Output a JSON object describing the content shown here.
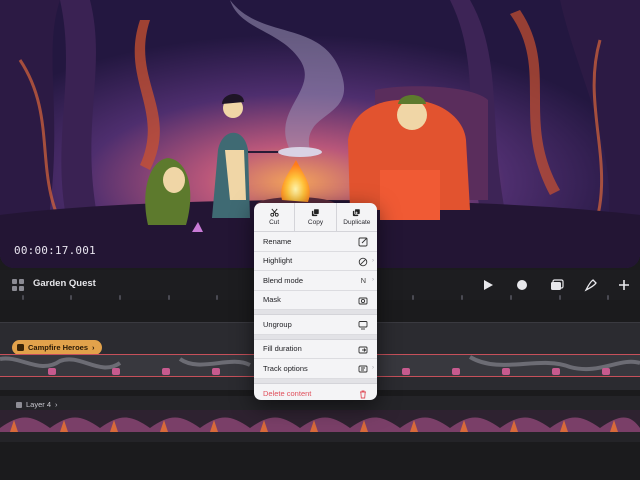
{
  "preview": {
    "timecode": "00:00:17.001"
  },
  "timeline": {
    "project_title": "Garden Quest",
    "toolbar": {
      "play": "play-icon",
      "record": "record-icon",
      "layers": "layers-icon",
      "draw": "brush-icon",
      "add": "plus-icon"
    },
    "tracks": [
      {
        "label": "Campfire Heroes",
        "type": "group"
      },
      {
        "label": "Layer 4",
        "type": "layer"
      }
    ]
  },
  "context_menu": {
    "top_actions": [
      {
        "label": "Cut",
        "icon": "scissors-icon"
      },
      {
        "label": "Copy",
        "icon": "copy-icon"
      },
      {
        "label": "Duplicate",
        "icon": "duplicate-icon"
      }
    ],
    "items": [
      {
        "label": "Rename",
        "icon": "edit-icon"
      },
      {
        "label": "Highlight",
        "icon": "slash-circle-icon"
      },
      {
        "label": "Blend mode",
        "value": "N"
      },
      {
        "label": "Mask",
        "icon": "mask-icon"
      },
      {
        "label": "Ungroup",
        "icon": "monitor-icon"
      },
      {
        "label": "Fill duration",
        "icon": "fill-duration-icon"
      },
      {
        "label": "Track options",
        "icon": "track-options-icon"
      },
      {
        "label": "Delete content",
        "icon": "trash-icon"
      }
    ],
    "colors": {
      "danger": "#e0505c",
      "group_accent": "#e2a24b"
    }
  }
}
